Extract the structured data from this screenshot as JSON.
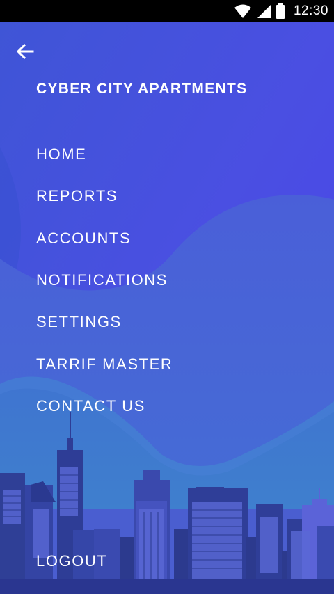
{
  "status_bar": {
    "time": "12:30",
    "icons": [
      "wifi-icon",
      "signal-icon",
      "battery-icon"
    ]
  },
  "drawer": {
    "title": "CYBER CITY APARTMENTS",
    "back_icon": "arrow-left-icon",
    "menu": [
      {
        "label": "HOME"
      },
      {
        "label": "REPORTS"
      },
      {
        "label": "ACCOUNTS"
      },
      {
        "label": "NOTIFICATIONS"
      },
      {
        "label": "SETTINGS"
      },
      {
        "label": "TARRIF MASTER"
      },
      {
        "label": "CONTACT US"
      }
    ],
    "logout_label": "LOGOUT"
  },
  "colors": {
    "gradient_top": "#4a46e6",
    "gradient_bottom": "#3e7fd0",
    "city_dark": "#2f3f8f",
    "city_mid": "#3a4aa8",
    "city_light": "#5b63d8"
  }
}
